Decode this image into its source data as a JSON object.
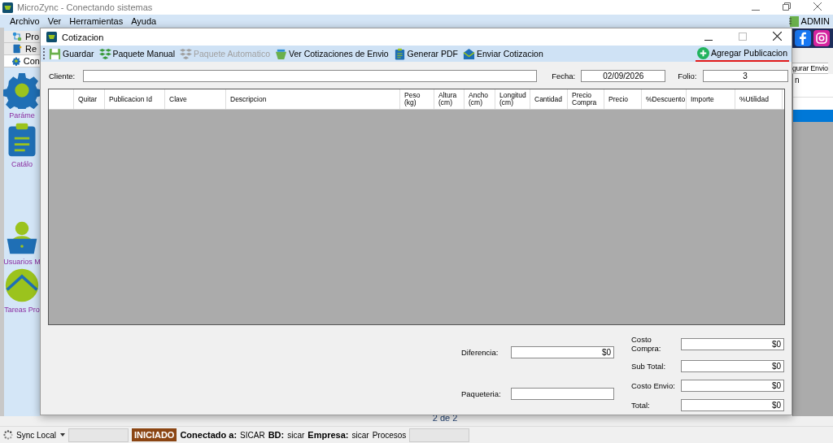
{
  "main_window": {
    "title": "MicroZync - Conectando sistemas",
    "menu": [
      "Archivo",
      "Ver",
      "Herramientas",
      "Ayuda"
    ],
    "user": "ADMIN"
  },
  "sidebar": {
    "tabs": [
      {
        "label": "Pro",
        "kind": "flow",
        "selected": false
      },
      {
        "label": "Re",
        "kind": "book",
        "selected": false
      },
      {
        "label": "Con",
        "kind": "gear",
        "selected": true
      }
    ],
    "items": [
      {
        "label": "Paráme",
        "kind": "gear"
      },
      {
        "label": "Catálo",
        "kind": "clipboard"
      },
      {
        "label": "Usuarios M",
        "kind": "user"
      },
      {
        "label": "Tareas Pro",
        "kind": "globe"
      }
    ]
  },
  "right_panel": {
    "tab": "gurar Envio",
    "column_1": "n"
  },
  "pager": "2 de 2",
  "status_bar": {
    "sync": "Sync Local",
    "state": "INICIADO",
    "connected_label": "Conectado a:",
    "connected": "SICAR",
    "db_label": "BD:",
    "db": "sicar",
    "company_label": "Empresa:",
    "company": "sicar",
    "processes": "Procesos"
  },
  "dialog": {
    "title": "Cotizacion",
    "toolbar": [
      {
        "label": "Guardar",
        "kind": "save",
        "disabled": false
      },
      {
        "label": "Paquete Manual",
        "kind": "boxes",
        "disabled": false
      },
      {
        "label": "Paquete Automatico",
        "kind": "boxes",
        "disabled": true
      },
      {
        "label": "Ver Cotizaciones de Envio",
        "kind": "basket",
        "disabled": false
      },
      {
        "label": "Generar PDF",
        "kind": "clipboard",
        "disabled": false
      },
      {
        "label": "Enviar Cotizacion",
        "kind": "envelope",
        "disabled": false
      }
    ],
    "add_button": "Agregar Publicacion",
    "fields": [
      {
        "label": "Cliente:"
      },
      {
        "label": "Fecha:",
        "value": "02/09/2026"
      },
      {
        "label": "Folio:",
        "value": "3"
      }
    ],
    "table": {
      "columns": [
        "Quitar",
        "Publicacion Id",
        "Clave",
        "Descripcion",
        "Peso (kg)",
        "Altura (cm)",
        "Ancho (cm)",
        "Longitud (cm)",
        "Cantidad",
        "Precio Compra",
        "Precio",
        "%Descuento",
        "Importe",
        "%Utilidad"
      ]
    },
    "summary_left": [
      {
        "label": "Diferencia:",
        "value": "$0"
      },
      {
        "label": "Paqueteria:"
      }
    ],
    "summary_right": [
      {
        "label": "Costo Compra:",
        "value": "$0"
      },
      {
        "label": "Sub Total:",
        "value": "$0"
      },
      {
        "label": "Costo Envio:",
        "value": "$0"
      },
      {
        "label": "Total:",
        "value": "$0"
      }
    ]
  }
}
